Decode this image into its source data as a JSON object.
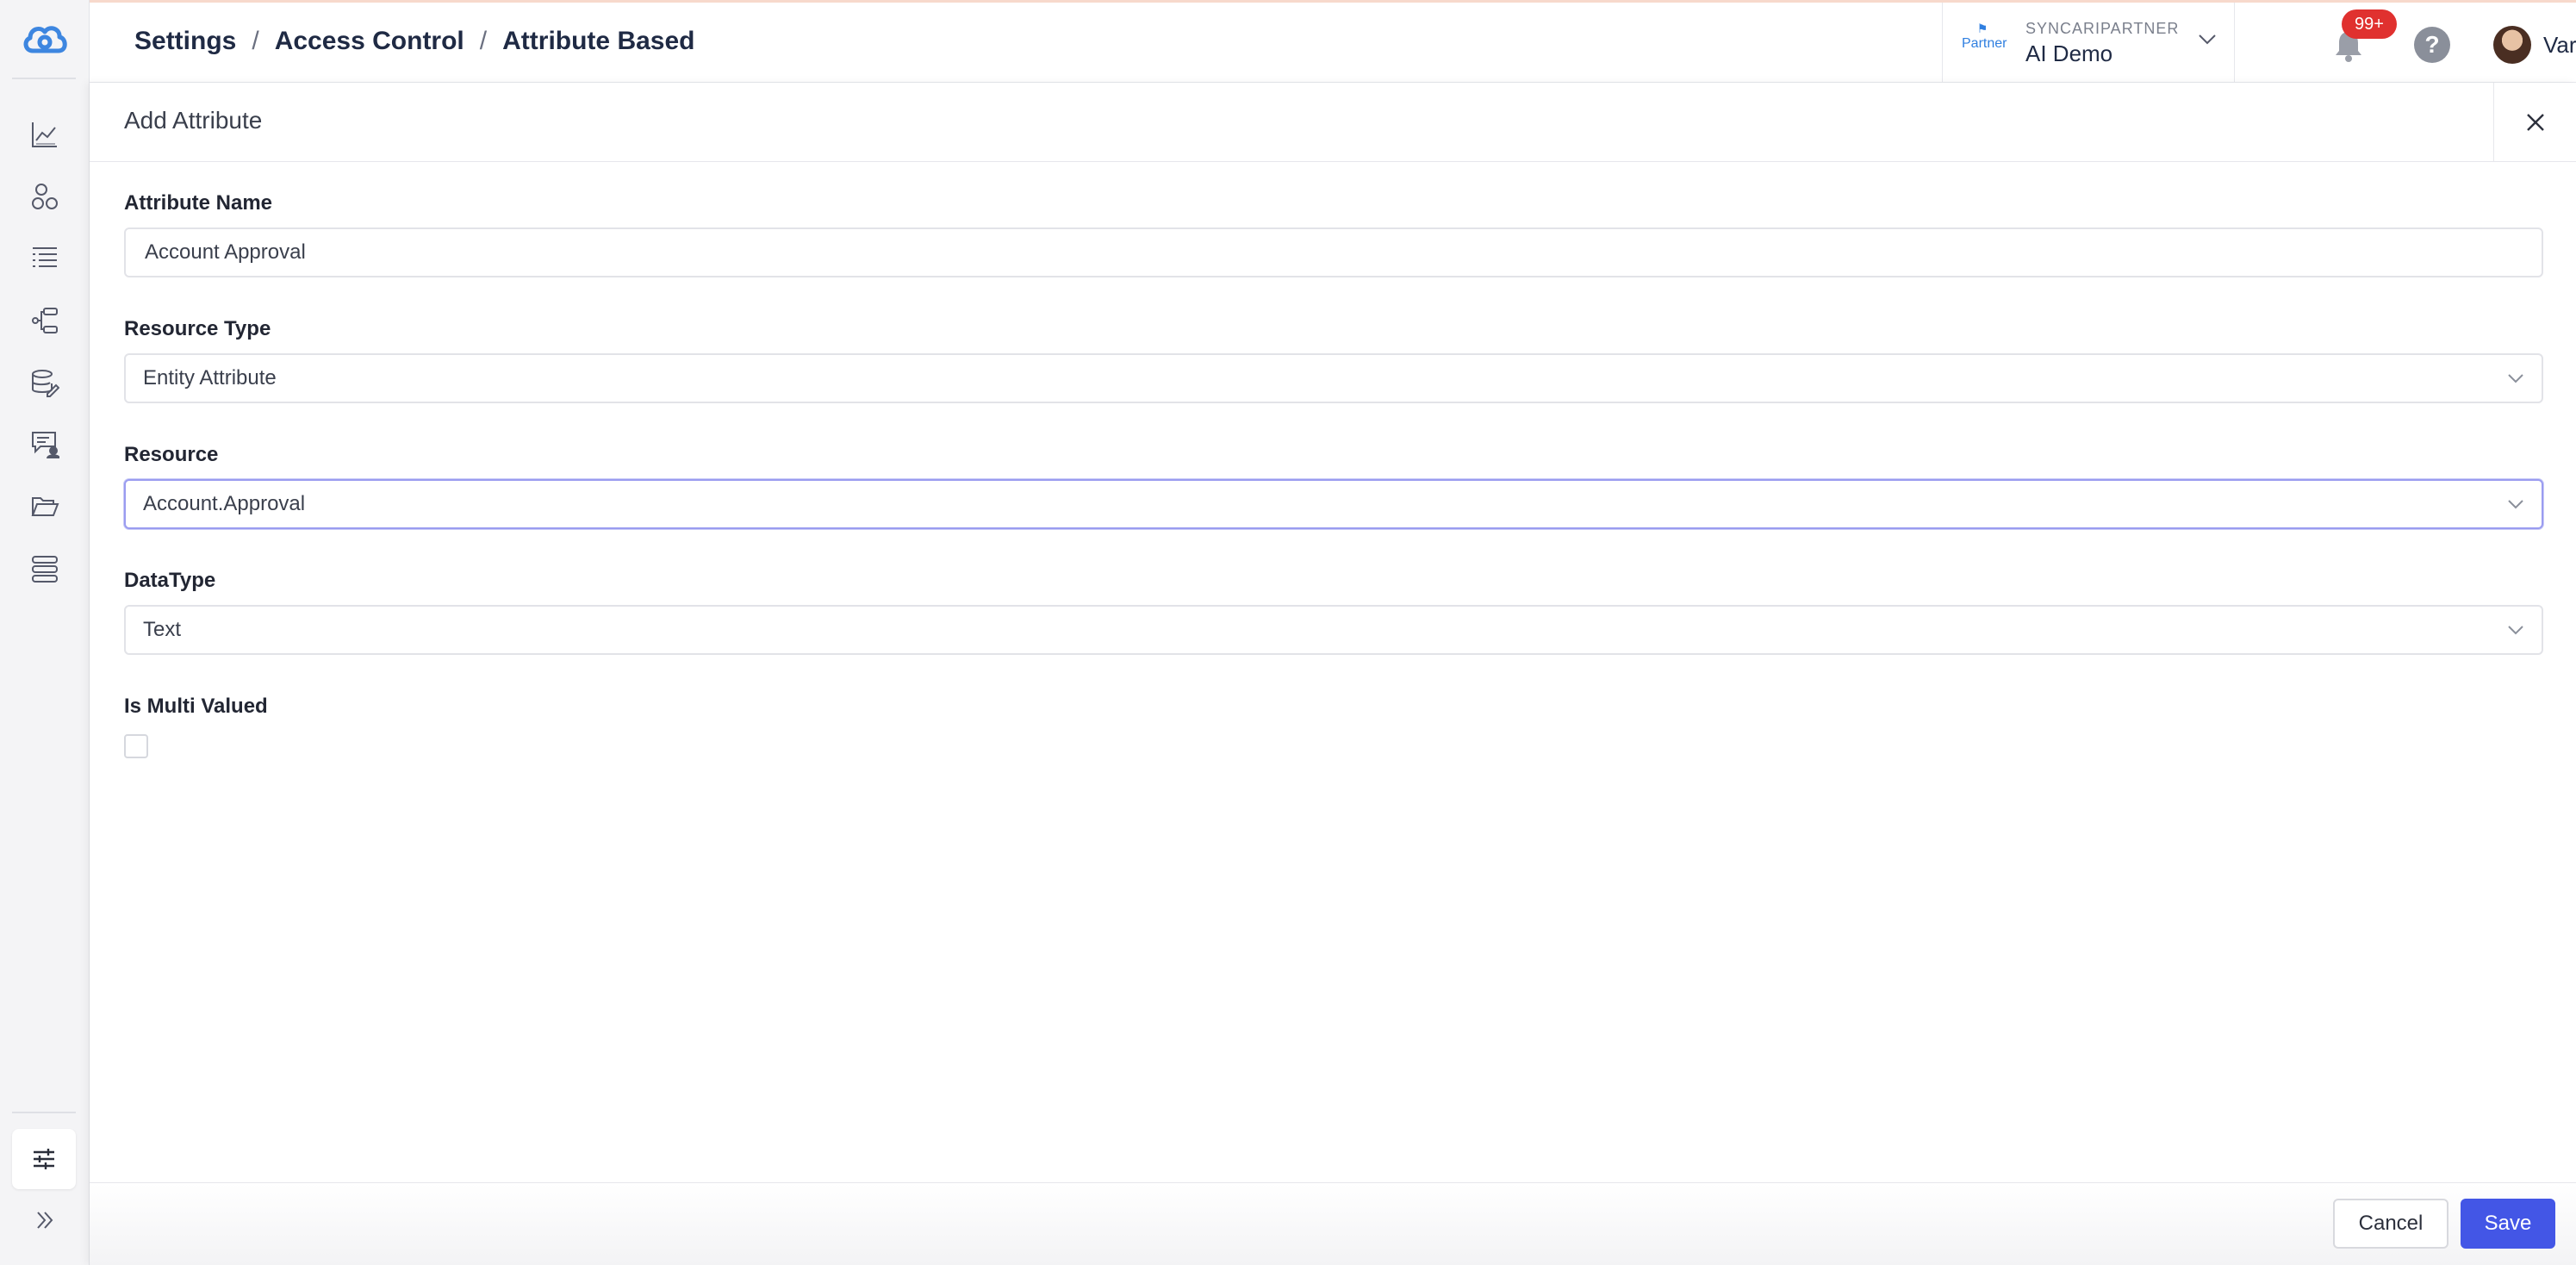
{
  "breadcrumb": {
    "items": [
      "Settings",
      "Access Control",
      "Attribute Based"
    ],
    "separator": "/"
  },
  "tenant": {
    "badge_label": "Partner",
    "org": "SYNCARIPARTNER",
    "name": "AI Demo"
  },
  "notifications": {
    "count": "99+"
  },
  "help": {
    "label": "?"
  },
  "user": {
    "name": "Varsha"
  },
  "panel": {
    "title": "Add Attribute",
    "fields": {
      "attribute_name": {
        "label": "Attribute Name",
        "value": "Account Approval"
      },
      "resource_type": {
        "label": "Resource Type",
        "value": "Entity Attribute"
      },
      "resource": {
        "label": "Resource",
        "value": "Account.Approval"
      },
      "datatype": {
        "label": "DataType",
        "value": "Text"
      },
      "multi_valued": {
        "label": "Is Multi Valued",
        "checked": false
      }
    },
    "buttons": {
      "cancel": "Cancel",
      "save": "Save"
    }
  },
  "colors": {
    "primary": "#4356e6",
    "badge": "#e0312f",
    "logo": "#3d86e0",
    "focus_border": "#9a9cf0"
  },
  "icons": {
    "sidebar": [
      "chart-line-icon",
      "nodes-icon",
      "list-icon",
      "flow-icon",
      "database-edit-icon",
      "user-chat-icon",
      "folder-open-icon",
      "stack-icon"
    ],
    "settings": "sliders-icon",
    "expand": "double-chevron-right-icon"
  }
}
